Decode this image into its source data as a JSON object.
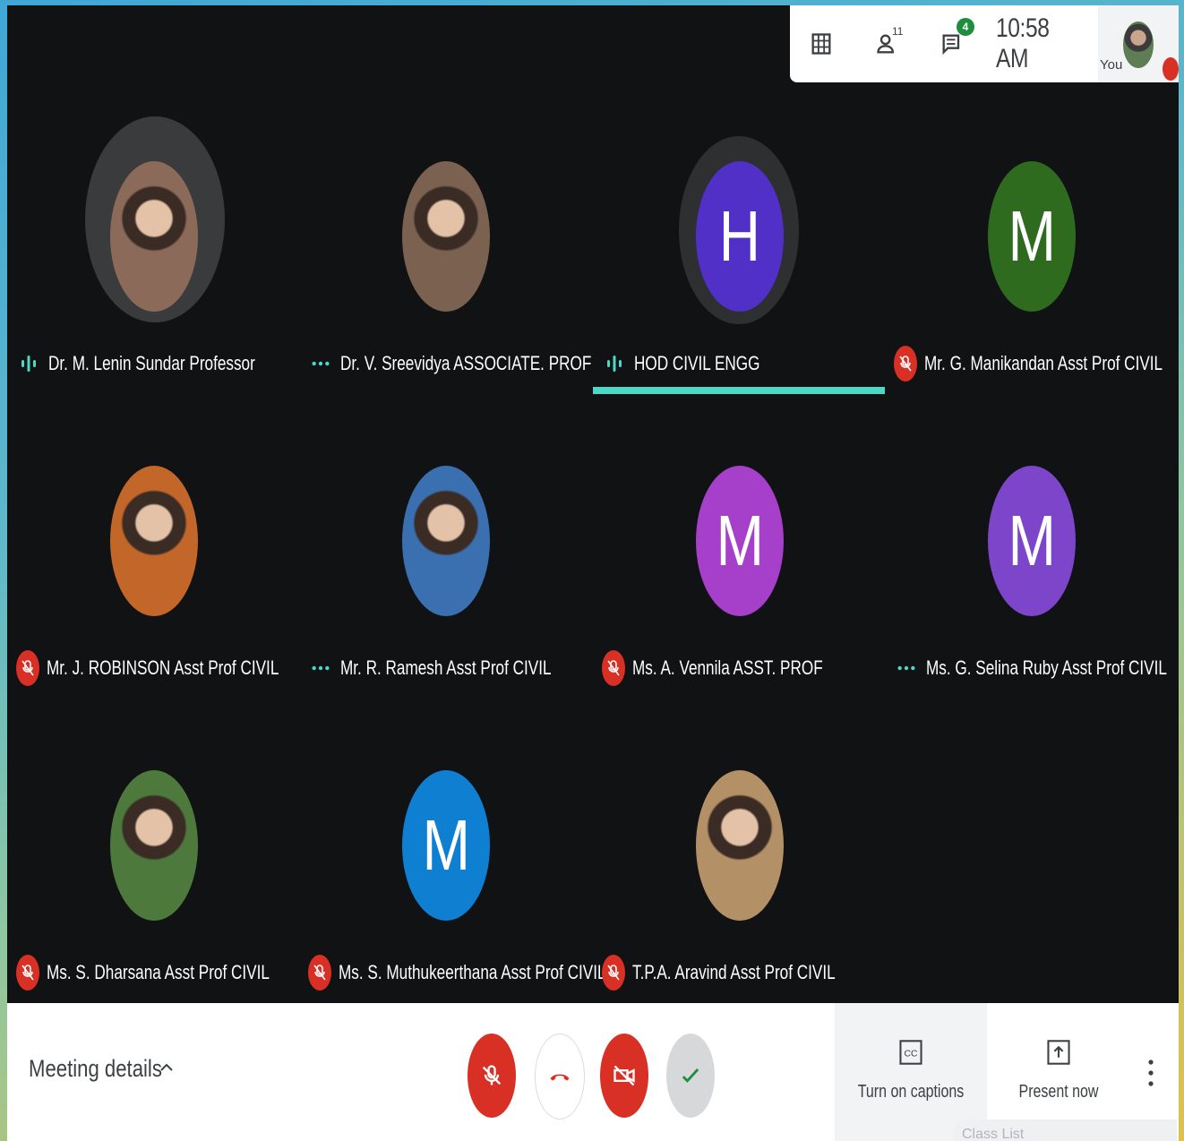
{
  "topbar": {
    "grid_icon": "grid-icon",
    "people_count": "11",
    "chat_badge": "4",
    "clock": "10:58 AM",
    "self_label": "You"
  },
  "participants": [
    {
      "name": "Dr. M. Lenin Sundar Professor",
      "status": "speaking",
      "avatar_type": "photo",
      "initial": "",
      "color": "#8b6a5a"
    },
    {
      "name": "Dr. V. Sreevidya ASSOCIATE. PROF",
      "status": "dots",
      "avatar_type": "photo",
      "initial": "",
      "color": "#7a6150"
    },
    {
      "name": "HOD CIVIL ENGG",
      "status": "speaking",
      "avatar_type": "initial",
      "initial": "H",
      "color": "#5130c8"
    },
    {
      "name": "Mr. G. Manikandan Asst Prof CIVIL",
      "status": "muted",
      "avatar_type": "initial",
      "initial": "M",
      "color": "#2e6b1f"
    },
    {
      "name": "Mr. J. ROBINSON Asst Prof CIVIL",
      "status": "muted",
      "avatar_type": "photo",
      "initial": "",
      "color": "#c2662a"
    },
    {
      "name": "Mr. R. Ramesh Asst Prof CIVIL",
      "status": "dots",
      "avatar_type": "photo",
      "initial": "",
      "color": "#3a6fb0"
    },
    {
      "name": "Ms. A. Vennila ASST. PROF",
      "status": "muted",
      "avatar_type": "initial",
      "initial": "M",
      "color": "#a63fc9"
    },
    {
      "name": "Ms. G. Selina Ruby Asst Prof CIVIL",
      "status": "dots",
      "avatar_type": "initial",
      "initial": "M",
      "color": "#7d45c9"
    },
    {
      "name": "Ms. S. Dharsana Asst Prof CIVIL",
      "status": "muted",
      "avatar_type": "photo",
      "initial": "",
      "color": "#4d7a3c"
    },
    {
      "name": "Ms. S. Muthukeerthana Asst Prof CIVIL",
      "status": "muted",
      "avatar_type": "initial",
      "initial": "M",
      "color": "#0e7fd1"
    },
    {
      "name": "T.P.A. Aravind Asst Prof CIVIL",
      "status": "muted",
      "avatar_type": "photo",
      "initial": "",
      "color": "#b39066"
    }
  ],
  "bottombar": {
    "meeting_details": "Meeting details",
    "captions_label": "Turn on captions",
    "present_label": "Present now",
    "class_list": "Class List"
  }
}
